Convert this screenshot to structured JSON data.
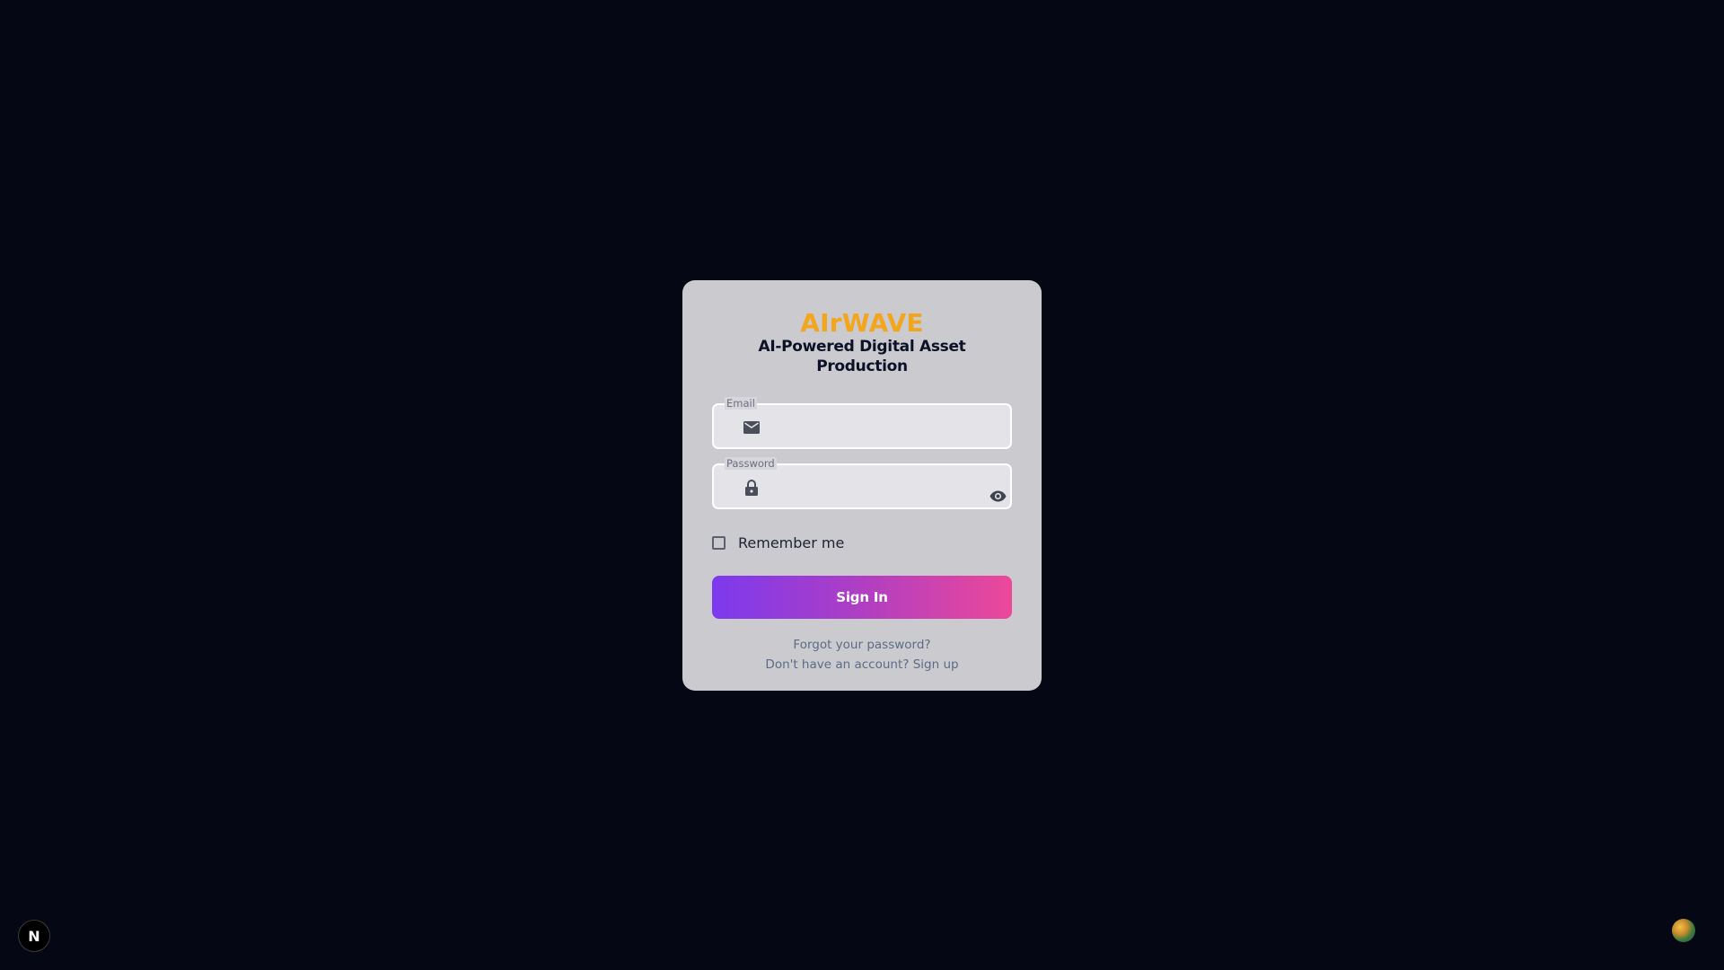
{
  "brand": {
    "title": "AIrWAVE",
    "tagline": "AI-Powered Digital Asset Production"
  },
  "form": {
    "email": {
      "label": "Email",
      "value": "",
      "icon": "mail-icon"
    },
    "password": {
      "label": "Password",
      "value": "",
      "icon": "lock-icon",
      "toggle_icon": "eye-icon"
    },
    "remember_label": "Remember me",
    "remember_checked": false,
    "submit_label": "Sign In"
  },
  "links": {
    "forgot": "Forgot your password?",
    "signup": "Don't have an account? Sign up"
  },
  "corner": {
    "badge_letter": "N"
  },
  "colors": {
    "background": "#050814",
    "card": "#cacacf",
    "brand": "#f3a51c",
    "button_start": "#7c3aed",
    "button_end": "#ec4899"
  }
}
